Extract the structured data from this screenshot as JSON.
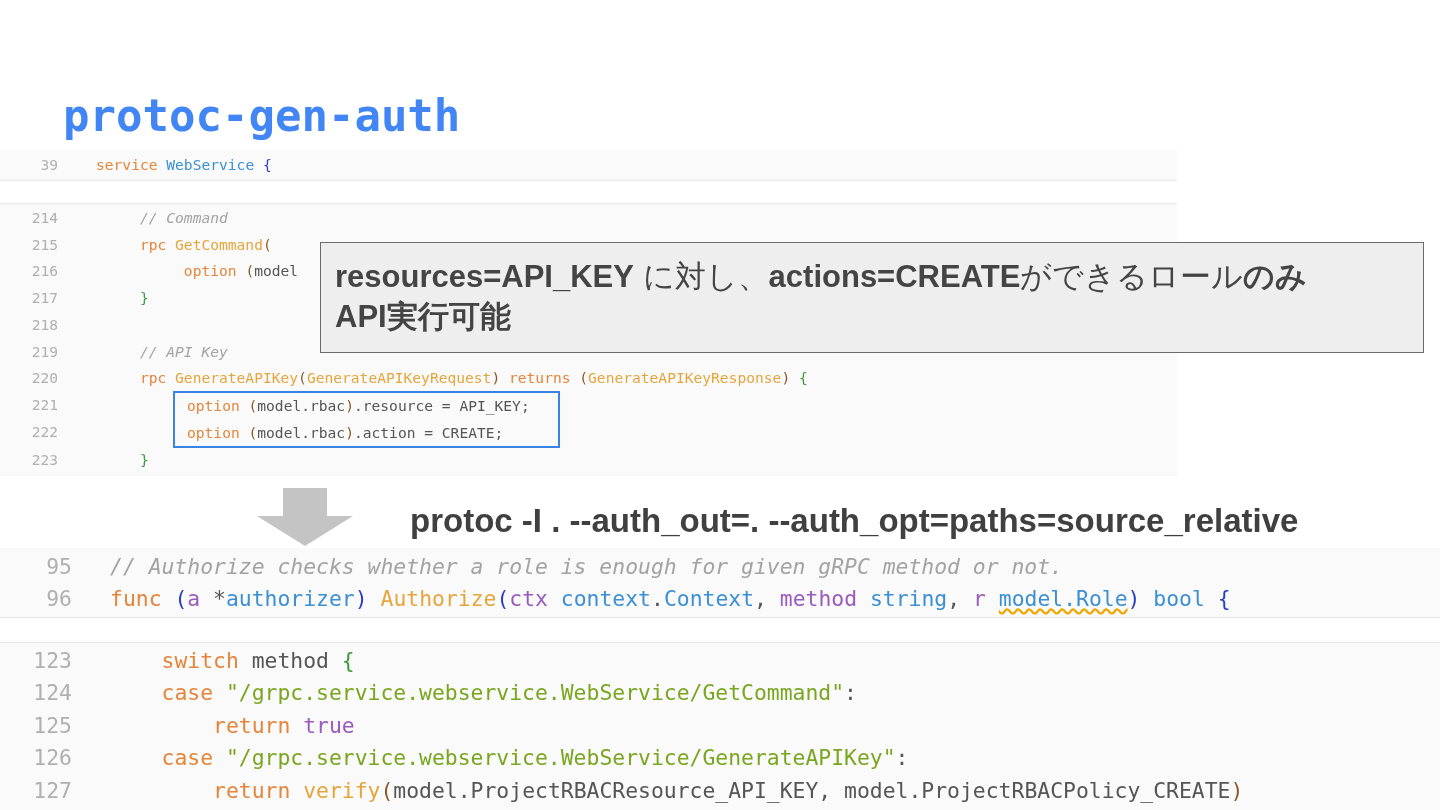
{
  "title": "protoc-gen-auth",
  "proto_panel": {
    "header": [
      {
        "number": "39",
        "highlighted": false,
        "tokens": [
          {
            "text": "service",
            "kind": "kw"
          },
          {
            "text": " WebService",
            "kind": "type"
          },
          {
            "text": " {",
            "kind": "brace"
          }
        ]
      }
    ],
    "lines": [
      {
        "number": "214",
        "highlighted": false,
        "tokens": [
          {
            "text": "     // Command",
            "kind": "comment"
          }
        ]
      },
      {
        "number": "215",
        "highlighted": false,
        "tokens": [
          {
            "text": "     rpc",
            "kind": "kw"
          },
          {
            "text": " GetCommand",
            "kind": "fn"
          },
          {
            "text": "(",
            "kind": "paren"
          }
        ]
      },
      {
        "number": "216",
        "highlighted": false,
        "tokens": [
          {
            "text": "          option",
            "kind": "kw"
          },
          {
            "text": " (",
            "kind": "paren"
          },
          {
            "text": "model",
            "kind": "plain"
          }
        ]
      },
      {
        "number": "217",
        "highlighted": false,
        "tokens": [
          {
            "text": "     }",
            "kind": "close"
          }
        ]
      },
      {
        "number": "218",
        "highlighted": false
      },
      {
        "number": "219",
        "highlighted": false,
        "tokens": [
          {
            "text": "     // API Key",
            "kind": "comment"
          }
        ]
      },
      {
        "number": "220",
        "highlighted": false,
        "tokens": [
          {
            "text": "     rpc",
            "kind": "kw"
          },
          {
            "text": " GenerateAPIKey",
            "kind": "fn"
          },
          {
            "text": "(",
            "kind": "paren"
          },
          {
            "text": "GenerateAPIKeyRequest",
            "kind": "fn"
          },
          {
            "text": ")",
            "kind": "paren"
          },
          {
            "text": " returns",
            "kind": "kw"
          },
          {
            "text": " (",
            "kind": "paren"
          },
          {
            "text": "GenerateAPIKeyResponse",
            "kind": "fn"
          },
          {
            "text": ")",
            "kind": "paren"
          },
          {
            "text": " {",
            "kind": "close"
          }
        ]
      },
      {
        "number": "221",
        "highlighted": true,
        "tokens": [
          {
            "text": "option",
            "kind": "kw"
          },
          {
            "text": " (",
            "kind": "paren"
          },
          {
            "text": "model.rbac",
            "kind": "plain"
          },
          {
            "text": ")",
            "kind": "paren"
          },
          {
            "text": ".resource = API_KEY;",
            "kind": "plain"
          }
        ]
      },
      {
        "number": "222",
        "highlighted": true,
        "tokens": [
          {
            "text": "option",
            "kind": "kw"
          },
          {
            "text": " (",
            "kind": "paren"
          },
          {
            "text": "model.rbac",
            "kind": "plain"
          },
          {
            "text": ")",
            "kind": "paren"
          },
          {
            "text": ".action = CREATE;",
            "kind": "plain"
          }
        ]
      },
      {
        "number": "223",
        "highlighted": false,
        "tokens": [
          {
            "text": "     }",
            "kind": "close"
          }
        ]
      }
    ]
  },
  "callout": "**resources=API_KEY** に対し、**actions=CREATE**ができるロール**のみ**\n**API実行可能**",
  "command": "protoc -I . --auth_out=. --auth_opt=paths=source_relative",
  "go_panel": {
    "header": [
      {
        "number": "95",
        "tokens": [
          {
            "text": "// Authorize checks whether a role is enough for given gRPC method or not.",
            "kind": "comment"
          }
        ]
      },
      {
        "number": "96",
        "tokens": [
          {
            "text": "func",
            "kind": "kw"
          },
          {
            "text": " (",
            "kind": "brace"
          },
          {
            "text": "a",
            "kind": "param"
          },
          {
            "text": " *",
            "kind": "plain"
          },
          {
            "text": "authorizer",
            "kind": "type"
          },
          {
            "text": ")",
            "kind": "brace"
          },
          {
            "text": " Authorize",
            "kind": "fn"
          },
          {
            "text": "(",
            "kind": "brace"
          },
          {
            "text": "ctx",
            "kind": "param"
          },
          {
            "text": " context",
            "kind": "type"
          },
          {
            "text": ".",
            "kind": "plain"
          },
          {
            "text": "Context",
            "kind": "type"
          },
          {
            "text": ",",
            "kind": "plain"
          },
          {
            "text": " method",
            "kind": "param"
          },
          {
            "text": " string",
            "kind": "type"
          },
          {
            "text": ",",
            "kind": "plain"
          },
          {
            "text": " r ",
            "kind": "param"
          },
          {
            "text": "model.Role",
            "kind": "warn-type"
          },
          {
            "text": ")",
            "kind": "brace"
          },
          {
            "text": " bool",
            "kind": "type"
          },
          {
            "text": " {",
            "kind": "brace"
          }
        ]
      }
    ],
    "lines": [
      {
        "number": "123",
        "tokens": [
          {
            "text": "    switch",
            "kind": "kw"
          },
          {
            "text": " method ",
            "kind": "plain"
          },
          {
            "text": "{",
            "kind": "close"
          }
        ]
      },
      {
        "number": "124",
        "tokens": [
          {
            "text": "    case",
            "kind": "kw"
          },
          {
            "text": " \"/grpc.service.webservice.WebService/GetCommand\"",
            "kind": "str"
          },
          {
            "text": ":",
            "kind": "plain"
          }
        ]
      },
      {
        "number": "125",
        "tokens": [
          {
            "text": "        return",
            "kind": "kw"
          },
          {
            "text": " true",
            "kind": "param"
          }
        ]
      },
      {
        "number": "126",
        "tokens": [
          {
            "text": "    case",
            "kind": "kw"
          },
          {
            "text": " \"/grpc.service.webservice.WebService/GenerateAPIKey\"",
            "kind": "str"
          },
          {
            "text": ":",
            "kind": "plain"
          }
        ]
      },
      {
        "number": "127",
        "tokens": [
          {
            "text": "        return",
            "kind": "kw"
          },
          {
            "text": " verify",
            "kind": "fn"
          },
          {
            "text": "(",
            "kind": "paren"
          },
          {
            "text": "model.ProjectRBACResource_API_KEY, model.ProjectRBACPolicy_CREATE",
            "kind": "plain"
          },
          {
            "text": ")",
            "kind": "paren"
          }
        ]
      }
    ]
  }
}
